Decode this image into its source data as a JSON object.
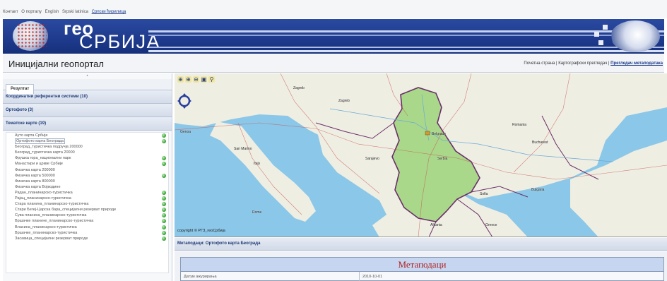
{
  "top_links": [
    "Контакт",
    "О порталу",
    "English",
    "Srpski latinica",
    "Српски ћирилица"
  ],
  "top_links_selected": 4,
  "logo": {
    "text_line1": "гео",
    "text_line2": "СРБИЈА",
    "icon": "globe-logo-icon"
  },
  "page": {
    "title": "Иницијални геопортал",
    "nav": [
      "Почетна страна",
      "Картографски прегледач",
      "Прегледач метаподатака"
    ],
    "nav_active": 2
  },
  "left_panel": {
    "tab_label": "Резултат",
    "sections": [
      {
        "label": "Координатни референтни системи (10)"
      },
      {
        "label": "Ортофото (3)"
      },
      {
        "label": "Тематске карте (19)"
      }
    ],
    "layers": [
      {
        "label": "Ауто карта Србије",
        "online": true
      },
      {
        "label": "Ортофото карта Београда",
        "online": true,
        "selected": true
      },
      {
        "label": "Београд_туристичка подручја 200000",
        "online": false
      },
      {
        "label": "Београд_туристичка карта 20000",
        "online": false
      },
      {
        "label": "Фрушка гора_национални парк",
        "online": true
      },
      {
        "label": "Манастири и цркве Србије",
        "online": true
      },
      {
        "label": "Физичка карта 200000",
        "online": false
      },
      {
        "label": "Физичка карта 500000",
        "online": true
      },
      {
        "label": "Физичка карта 800000",
        "online": false
      },
      {
        "label": "Физичка карта Војводине",
        "online": false
      },
      {
        "label": "Радан_планинарско-туристичка",
        "online": true
      },
      {
        "label": "Рајац_планинарско-туристичка",
        "online": true
      },
      {
        "label": "Стара планина_планинарско-туристичка",
        "online": true
      },
      {
        "label": "Стари Бегеј-Царска бара_специјални резерват природе",
        "online": true
      },
      {
        "label": "Сува планина_планинарско-туристичка",
        "online": true
      },
      {
        "label": "Вршачке планине_планинарско-туристичка",
        "online": true
      },
      {
        "label": "Власина_планинарско-туристичка",
        "online": true
      },
      {
        "label": "Вршачке_планинарско-туристичка",
        "online": true
      },
      {
        "label": "Засавица_специјални резерват природе",
        "online": true
      }
    ]
  },
  "map": {
    "tools": [
      "zoom-in-icon",
      "zoom-in-box-icon",
      "zoom-out-icon",
      "print-icon",
      "binoculars-icon"
    ],
    "cities": [
      "Zagreb",
      "Zagreb",
      "Belgrade",
      "Bucharest",
      "Sofia",
      "Rome",
      "San Marino",
      "Genoa",
      "Romania",
      "Serbia",
      "Sarajevo",
      "Bulgaria",
      "Greece",
      "Albania",
      "Italy"
    ],
    "copyright": "copyright © РГЗ_геоСрбија",
    "colors": {
      "sea": "#8bc7e8",
      "land": "#efeee2",
      "highlight": "#a9d88a",
      "border": "#6a2f6a"
    }
  },
  "metadata": {
    "bar_title": "Метаподаци: Ортофото карта Београда",
    "header": "Метаподаци",
    "row_key": "Датум ажурирања",
    "row_value": "2010-10-01"
  }
}
